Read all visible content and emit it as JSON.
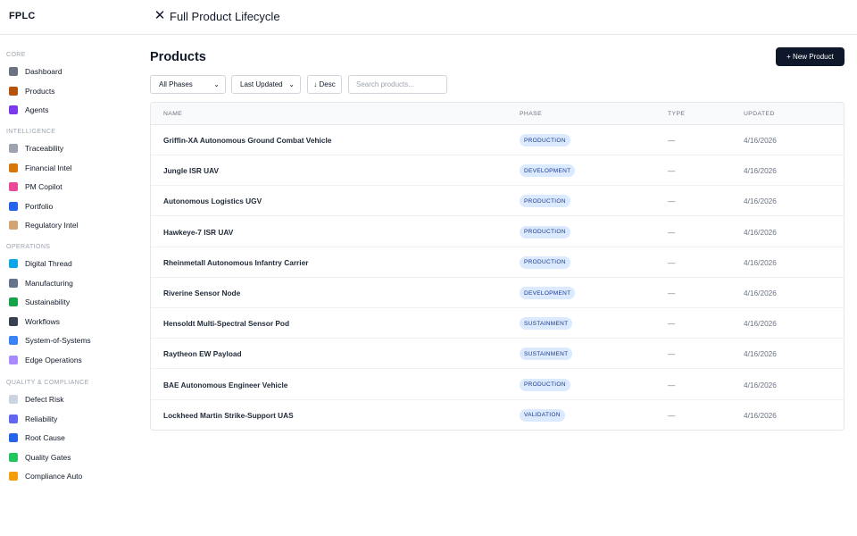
{
  "app": {
    "brand": "FPLC",
    "title": "Full Product Lifecycle",
    "close_glyph": "✕"
  },
  "sidebar": {
    "sections": [
      {
        "title": "CORE",
        "items": [
          {
            "label": "Dashboard",
            "icon": "bar-chart-icon",
            "color": "#6b7280"
          },
          {
            "label": "Products",
            "icon": "package-icon",
            "color": "#b45309"
          },
          {
            "label": "Agents",
            "icon": "robot-icon",
            "color": "#7c3aed"
          }
        ]
      },
      {
        "title": "INTELLIGENCE",
        "items": [
          {
            "label": "Traceability",
            "icon": "link-icon",
            "color": "#9ca3af"
          },
          {
            "label": "Financial Intel",
            "icon": "money-bag-icon",
            "color": "#d97706"
          },
          {
            "label": "PM Copilot",
            "icon": "brain-icon",
            "color": "#ec4899"
          },
          {
            "label": "Portfolio",
            "icon": "bar-chart-icon",
            "color": "#2563eb"
          },
          {
            "label": "Regulatory Intel",
            "icon": "scroll-icon",
            "color": "#d4a373"
          }
        ]
      },
      {
        "title": "OPERATIONS",
        "items": [
          {
            "label": "Digital Thread",
            "icon": "globe-icon",
            "color": "#0ea5e9"
          },
          {
            "label": "Manufacturing",
            "icon": "factory-icon",
            "color": "#64748b"
          },
          {
            "label": "Sustainability",
            "icon": "seedling-icon",
            "color": "#16a34a"
          },
          {
            "label": "Workflows",
            "icon": "gear-icon",
            "color": "#374151"
          },
          {
            "label": "System-of-Systems",
            "icon": "network-icon",
            "color": "#3b82f6"
          },
          {
            "label": "Edge Operations",
            "icon": "satellite-icon",
            "color": "#a78bfa"
          }
        ]
      },
      {
        "title": "QUALITY & COMPLIANCE",
        "items": [
          {
            "label": "Defect Risk",
            "icon": "shield-icon",
            "color": "#cbd5e1"
          },
          {
            "label": "Reliability",
            "icon": "trend-chart-icon",
            "color": "#6366f1"
          },
          {
            "label": "Root Cause",
            "icon": "magnifier-icon",
            "color": "#2563eb"
          },
          {
            "label": "Quality Gates",
            "icon": "checkbox-icon",
            "color": "#22c55e"
          },
          {
            "label": "Compliance Auto",
            "icon": "lock-icon",
            "color": "#f59e0b"
          }
        ]
      }
    ]
  },
  "main": {
    "page_title": "Products",
    "new_button": "+ New Product",
    "filters": {
      "phase": "All Phases",
      "sort": "Last Updated",
      "direction": "↓ Desc",
      "search_placeholder": "Search products..."
    },
    "table": {
      "headers": {
        "name": "NAME",
        "phase": "PHASE",
        "type": "TYPE",
        "updated": "UPDATED"
      },
      "rows": [
        {
          "name": "Griffin-XA Autonomous Ground Combat Vehicle",
          "phase": "PRODUCTION",
          "type": "—",
          "updated": "4/16/2026"
        },
        {
          "name": "Jungle ISR UAV",
          "phase": "DEVELOPMENT",
          "type": "—",
          "updated": "4/16/2026"
        },
        {
          "name": "Autonomous Logistics UGV",
          "phase": "PRODUCTION",
          "type": "—",
          "updated": "4/16/2026"
        },
        {
          "name": "Hawkeye-7 ISR UAV",
          "phase": "PRODUCTION",
          "type": "—",
          "updated": "4/16/2026"
        },
        {
          "name": "Rheinmetall Autonomous Infantry Carrier",
          "phase": "PRODUCTION",
          "type": "—",
          "updated": "4/16/2026"
        },
        {
          "name": "Riverine Sensor Node",
          "phase": "DEVELOPMENT",
          "type": "—",
          "updated": "4/16/2026"
        },
        {
          "name": "Hensoldt Multi-Spectral Sensor Pod",
          "phase": "SUSTAINMENT",
          "type": "—",
          "updated": "4/16/2026"
        },
        {
          "name": "Raytheon EW Payload",
          "phase": "SUSTAINMENT",
          "type": "—",
          "updated": "4/16/2026"
        },
        {
          "name": "BAE Autonomous Engineer Vehicle",
          "phase": "PRODUCTION",
          "type": "—",
          "updated": "4/16/2026"
        },
        {
          "name": "Lockheed Martin Strike-Support UAS",
          "phase": "VALIDATION",
          "type": "—",
          "updated": "4/16/2026"
        }
      ]
    }
  },
  "colors": {
    "primary_button": "#0f172a",
    "badge_bg": "#dbeafe",
    "badge_text": "#1e3a8a"
  }
}
